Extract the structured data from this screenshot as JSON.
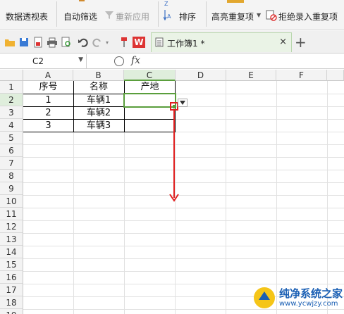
{
  "ribbon": {
    "pivot_label": "数据透视表",
    "autofilter_label": "自动筛选",
    "reapply_label": "重新应用",
    "sort_label": "排序",
    "highlight_dup_label": "高亮重复项",
    "reject_dup_label": "拒绝录入重复项"
  },
  "quick_access": {
    "icons": [
      "folder-icon",
      "save-icon",
      "export-pdf-icon",
      "print-icon",
      "print-preview-icon",
      "undo-icon",
      "redo-icon",
      "format-painter-icon"
    ]
  },
  "tabs": {
    "app_logo": "W",
    "doc_title": "工作簿1 *",
    "close": "×",
    "new_tab": "+"
  },
  "formula_bar": {
    "name_box": "C2",
    "fx_label": "fx",
    "formula": ""
  },
  "sheet": {
    "columns": [
      "A",
      "B",
      "C",
      "D",
      "E",
      "F"
    ],
    "rows": [
      "1",
      "2",
      "3",
      "4",
      "5",
      "6",
      "7",
      "8",
      "9",
      "10",
      "11",
      "12",
      "13",
      "14",
      "15",
      "16",
      "17",
      "18",
      "19"
    ],
    "header_row": [
      "序号",
      "名称",
      "产地"
    ],
    "data_rows": [
      [
        "1",
        "车辆1",
        ""
      ],
      [
        "2",
        "车辆2",
        ""
      ],
      [
        "3",
        "车辆3",
        ""
      ]
    ],
    "active_cell": "C2"
  },
  "colors": {
    "selection_green": "#5a9e3c",
    "annotation_red": "#e02020"
  },
  "watermark": {
    "title": "纯净系统之家",
    "url": "www.ycwjzy.com"
  }
}
